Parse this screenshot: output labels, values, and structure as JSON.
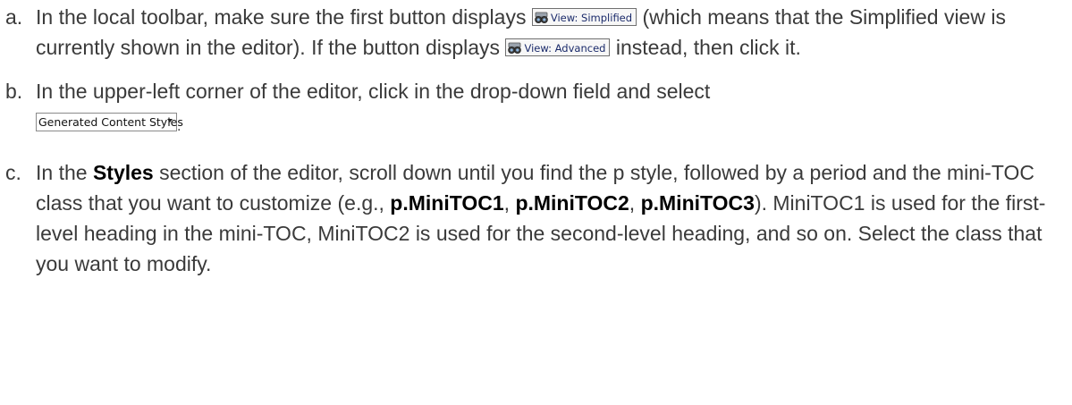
{
  "steps": [
    {
      "marker": "a.",
      "seg1": "In the local toolbar, make sure the first button displays ",
      "button_label": "View: Simplified",
      "seg2": " (which means that the Simplified view is currently shown in the editor). If the button displays ",
      "button_label_2": "View: Advanced",
      "seg3": " instead, then click it."
    },
    {
      "marker": "b.",
      "seg1": "In the upper-left corner of the editor, click in the drop-down field and select ",
      "dropdown_value": "Generated Content Styles",
      "seg2": "."
    },
    {
      "marker": "c.",
      "seg1": "In the ",
      "bold1": "Styles",
      "seg2": " section of the editor, scroll down until you find the p style, followed by a period and the mini-TOC class that you want to customize (e.g., ",
      "bold2": "p.MiniTOC1",
      "seg3": ", ",
      "bold3": "p.MiniTOC2",
      "seg4": ", ",
      "bold4": "p.MiniTOC3",
      "seg5": "). MiniTOC1 is used for the first-level heading in the mini-TOC, MiniTOC2 is used for the second-level heading, and so on. Select the class that you want to modify."
    }
  ],
  "icons": {
    "view_button": "binoculars-icon",
    "dropdown": "chevron-down-icon"
  }
}
